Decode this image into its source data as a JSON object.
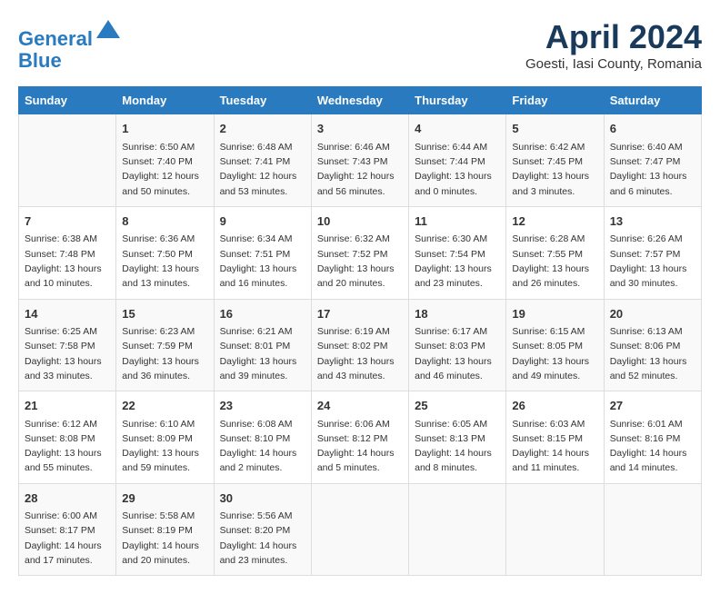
{
  "header": {
    "logo_line1": "General",
    "logo_line2": "Blue",
    "month": "April 2024",
    "location": "Goesti, Iasi County, Romania"
  },
  "days_of_week": [
    "Sunday",
    "Monday",
    "Tuesday",
    "Wednesday",
    "Thursday",
    "Friday",
    "Saturday"
  ],
  "weeks": [
    [
      {
        "day": "",
        "info": ""
      },
      {
        "day": "1",
        "info": "Sunrise: 6:50 AM\nSunset: 7:40 PM\nDaylight: 12 hours\nand 50 minutes."
      },
      {
        "day": "2",
        "info": "Sunrise: 6:48 AM\nSunset: 7:41 PM\nDaylight: 12 hours\nand 53 minutes."
      },
      {
        "day": "3",
        "info": "Sunrise: 6:46 AM\nSunset: 7:43 PM\nDaylight: 12 hours\nand 56 minutes."
      },
      {
        "day": "4",
        "info": "Sunrise: 6:44 AM\nSunset: 7:44 PM\nDaylight: 13 hours\nand 0 minutes."
      },
      {
        "day": "5",
        "info": "Sunrise: 6:42 AM\nSunset: 7:45 PM\nDaylight: 13 hours\nand 3 minutes."
      },
      {
        "day": "6",
        "info": "Sunrise: 6:40 AM\nSunset: 7:47 PM\nDaylight: 13 hours\nand 6 minutes."
      }
    ],
    [
      {
        "day": "7",
        "info": "Sunrise: 6:38 AM\nSunset: 7:48 PM\nDaylight: 13 hours\nand 10 minutes."
      },
      {
        "day": "8",
        "info": "Sunrise: 6:36 AM\nSunset: 7:50 PM\nDaylight: 13 hours\nand 13 minutes."
      },
      {
        "day": "9",
        "info": "Sunrise: 6:34 AM\nSunset: 7:51 PM\nDaylight: 13 hours\nand 16 minutes."
      },
      {
        "day": "10",
        "info": "Sunrise: 6:32 AM\nSunset: 7:52 PM\nDaylight: 13 hours\nand 20 minutes."
      },
      {
        "day": "11",
        "info": "Sunrise: 6:30 AM\nSunset: 7:54 PM\nDaylight: 13 hours\nand 23 minutes."
      },
      {
        "day": "12",
        "info": "Sunrise: 6:28 AM\nSunset: 7:55 PM\nDaylight: 13 hours\nand 26 minutes."
      },
      {
        "day": "13",
        "info": "Sunrise: 6:26 AM\nSunset: 7:57 PM\nDaylight: 13 hours\nand 30 minutes."
      }
    ],
    [
      {
        "day": "14",
        "info": "Sunrise: 6:25 AM\nSunset: 7:58 PM\nDaylight: 13 hours\nand 33 minutes."
      },
      {
        "day": "15",
        "info": "Sunrise: 6:23 AM\nSunset: 7:59 PM\nDaylight: 13 hours\nand 36 minutes."
      },
      {
        "day": "16",
        "info": "Sunrise: 6:21 AM\nSunset: 8:01 PM\nDaylight: 13 hours\nand 39 minutes."
      },
      {
        "day": "17",
        "info": "Sunrise: 6:19 AM\nSunset: 8:02 PM\nDaylight: 13 hours\nand 43 minutes."
      },
      {
        "day": "18",
        "info": "Sunrise: 6:17 AM\nSunset: 8:03 PM\nDaylight: 13 hours\nand 46 minutes."
      },
      {
        "day": "19",
        "info": "Sunrise: 6:15 AM\nSunset: 8:05 PM\nDaylight: 13 hours\nand 49 minutes."
      },
      {
        "day": "20",
        "info": "Sunrise: 6:13 AM\nSunset: 8:06 PM\nDaylight: 13 hours\nand 52 minutes."
      }
    ],
    [
      {
        "day": "21",
        "info": "Sunrise: 6:12 AM\nSunset: 8:08 PM\nDaylight: 13 hours\nand 55 minutes."
      },
      {
        "day": "22",
        "info": "Sunrise: 6:10 AM\nSunset: 8:09 PM\nDaylight: 13 hours\nand 59 minutes."
      },
      {
        "day": "23",
        "info": "Sunrise: 6:08 AM\nSunset: 8:10 PM\nDaylight: 14 hours\nand 2 minutes."
      },
      {
        "day": "24",
        "info": "Sunrise: 6:06 AM\nSunset: 8:12 PM\nDaylight: 14 hours\nand 5 minutes."
      },
      {
        "day": "25",
        "info": "Sunrise: 6:05 AM\nSunset: 8:13 PM\nDaylight: 14 hours\nand 8 minutes."
      },
      {
        "day": "26",
        "info": "Sunrise: 6:03 AM\nSunset: 8:15 PM\nDaylight: 14 hours\nand 11 minutes."
      },
      {
        "day": "27",
        "info": "Sunrise: 6:01 AM\nSunset: 8:16 PM\nDaylight: 14 hours\nand 14 minutes."
      }
    ],
    [
      {
        "day": "28",
        "info": "Sunrise: 6:00 AM\nSunset: 8:17 PM\nDaylight: 14 hours\nand 17 minutes."
      },
      {
        "day": "29",
        "info": "Sunrise: 5:58 AM\nSunset: 8:19 PM\nDaylight: 14 hours\nand 20 minutes."
      },
      {
        "day": "30",
        "info": "Sunrise: 5:56 AM\nSunset: 8:20 PM\nDaylight: 14 hours\nand 23 minutes."
      },
      {
        "day": "",
        "info": ""
      },
      {
        "day": "",
        "info": ""
      },
      {
        "day": "",
        "info": ""
      },
      {
        "day": "",
        "info": ""
      }
    ]
  ]
}
